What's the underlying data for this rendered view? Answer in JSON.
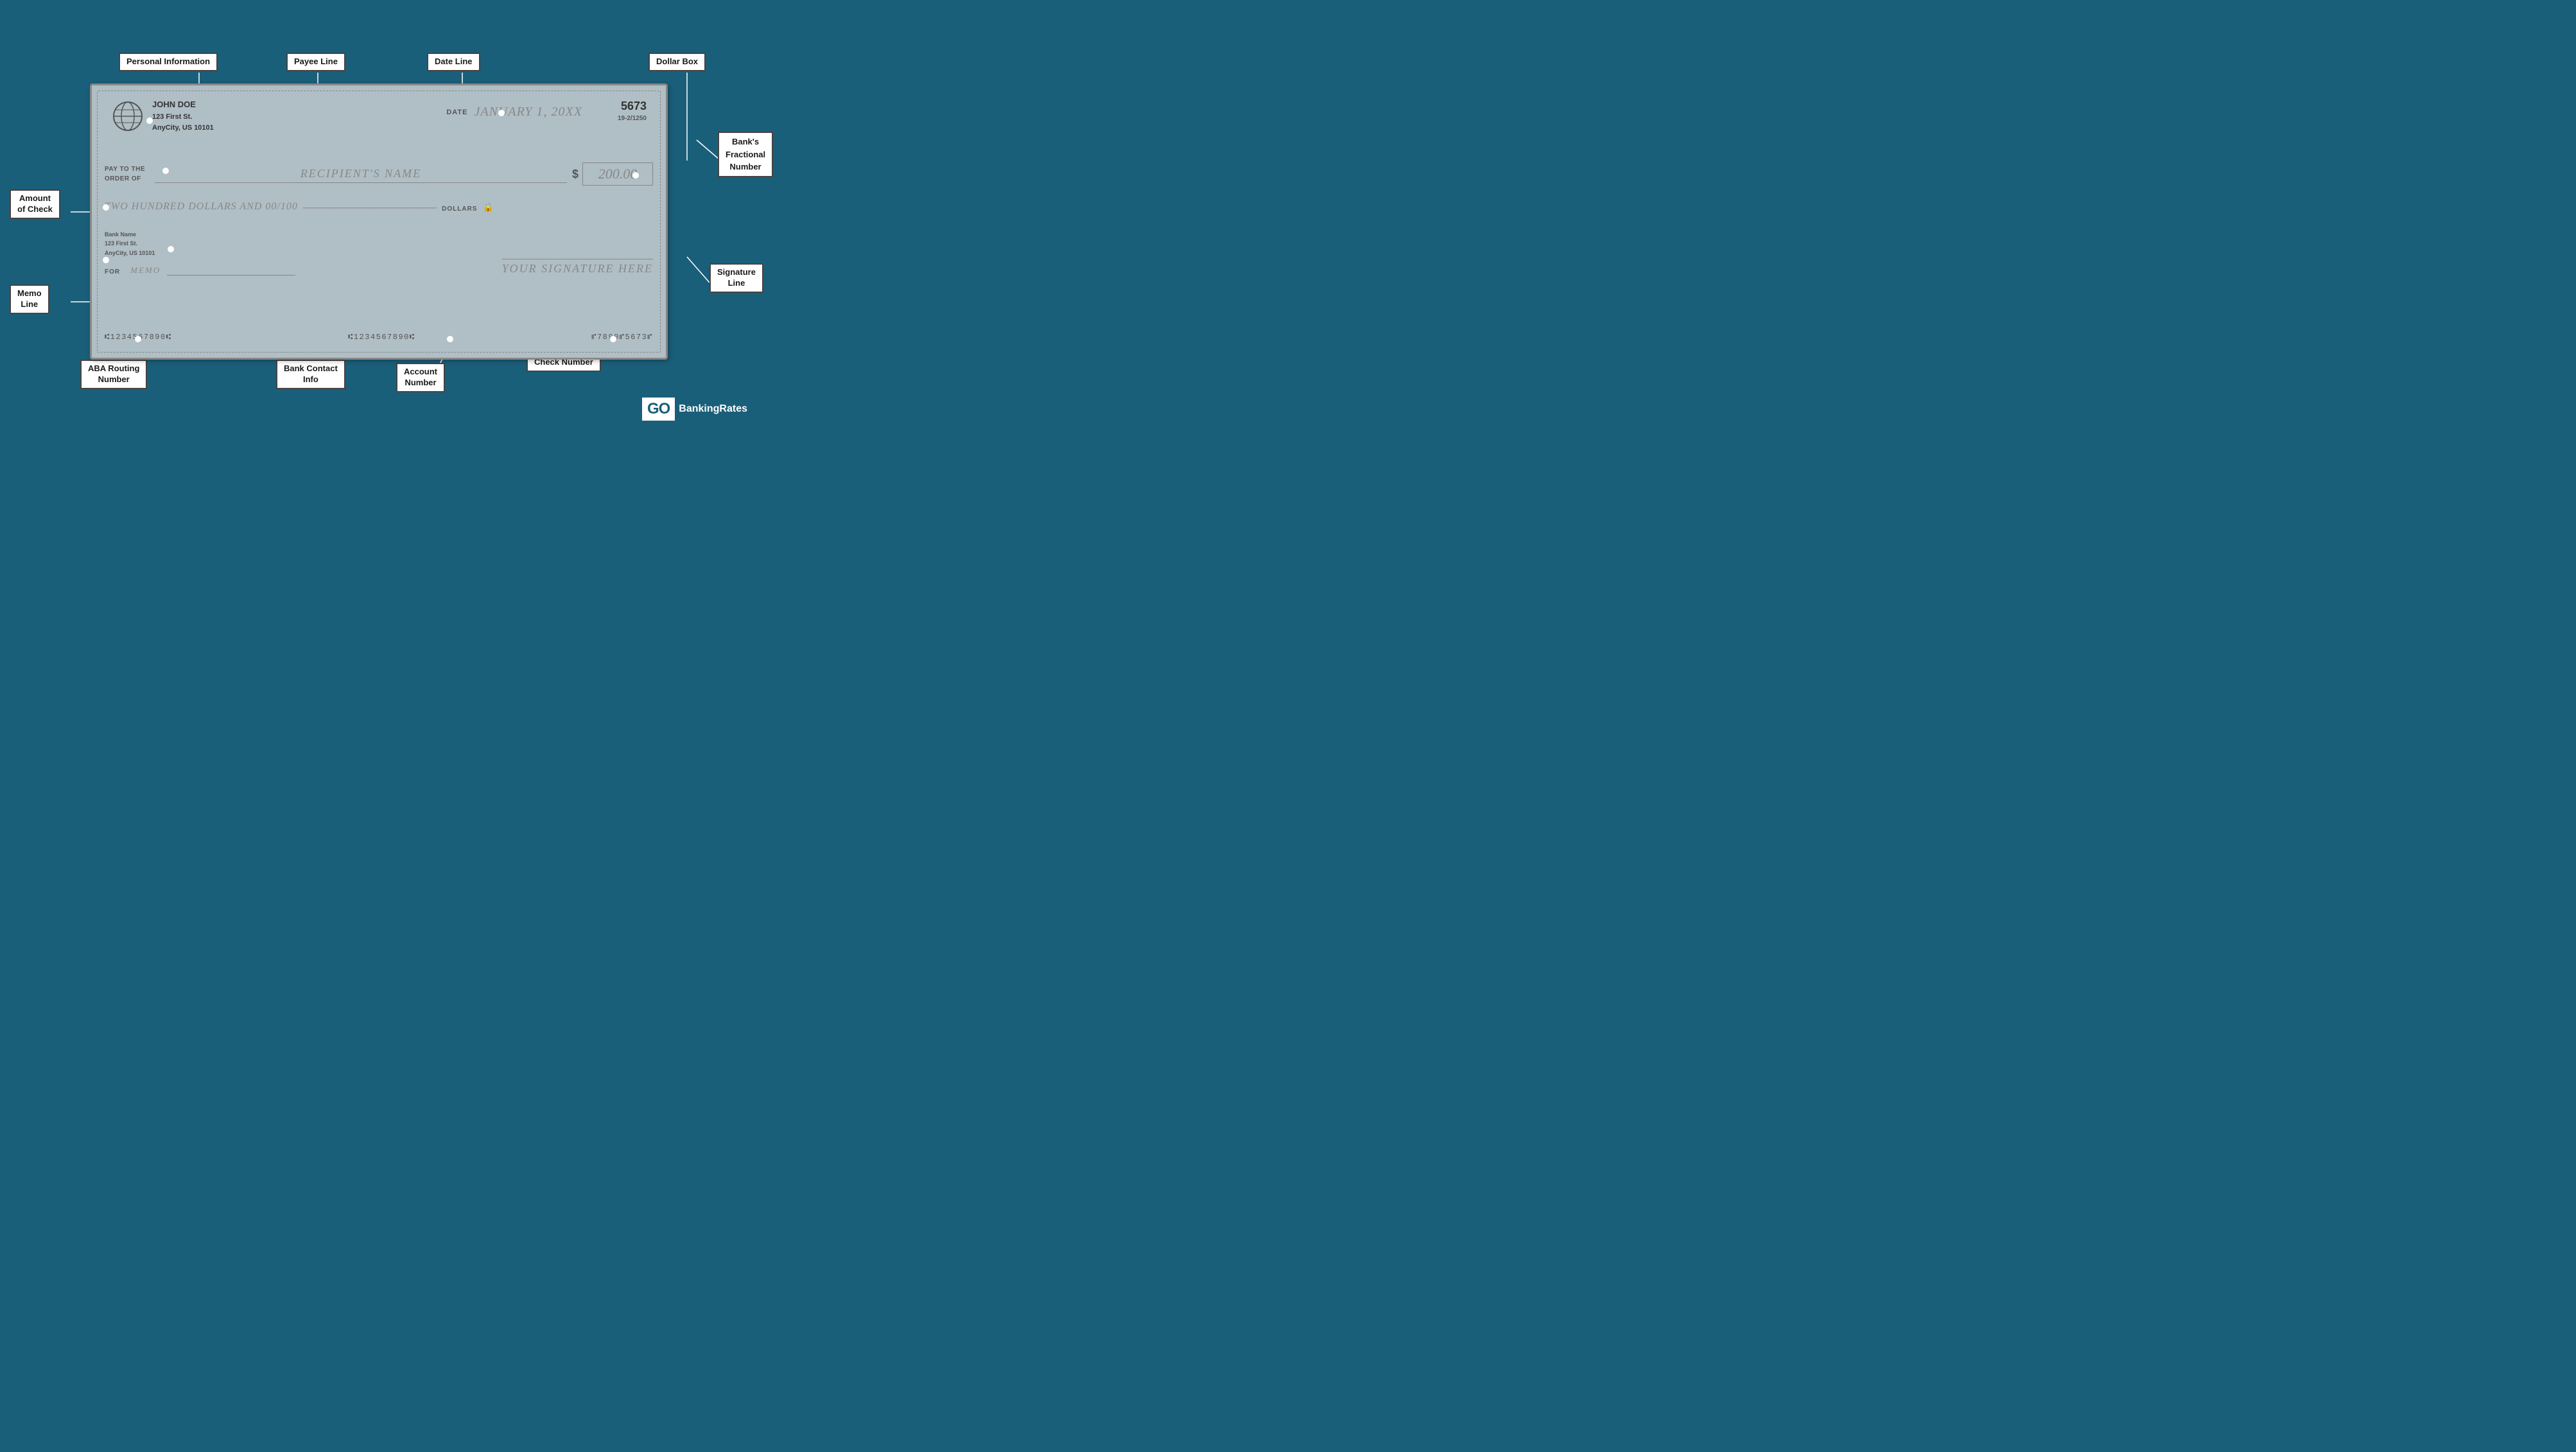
{
  "labels": {
    "personal_information": "Personal Information",
    "payee_line": "Payee Line",
    "date_line": "Date Line",
    "dollar_box": "Dollar Box",
    "banks_fractional_number": "Bank's\nFractional\nNumber",
    "amount_of_check": "Amount\nof Check",
    "memo_line": "Memo\nLine",
    "aba_routing_number": "ABA Routing\nNumber",
    "bank_contact_info": "Bank Contact\nInfo",
    "account_number": "Account\nNumber",
    "check_number": "Check Number",
    "signature_line": "Signature\nLine"
  },
  "check": {
    "check_number_top": "5673",
    "fractional": "19-2/1250",
    "owner_name": "JOHN DOE",
    "owner_address1": "123 First St.",
    "owner_address2": "AnyCity, US 10101",
    "date_label": "DATE",
    "date_value": "JANUARY 1, 20XX",
    "pay_to_label": "PAY TO THE\nORDER OF",
    "payee_name": "RECIPIENT'S NAME",
    "dollar_sign": "$",
    "amount_box": "200.00",
    "amount_written": "TWO HUNDRED DOLLARS AND 00/100",
    "dollars_label": "DOLLARS",
    "bank_name": "Bank Name",
    "bank_addr1": "123 First St.",
    "bank_addr2": "AnyCity, US 10101",
    "for_label": "FOR",
    "memo_text": "MEMO",
    "signature_text": "YOUR SIGNATURE HERE",
    "micr_routing": "⑆1234567890⑆",
    "micr_account": "⑆1234567890⑆",
    "micr_check": "⑈7890⑈5673⑈"
  },
  "logo": {
    "go": "GO",
    "banking": "BankingRates"
  }
}
